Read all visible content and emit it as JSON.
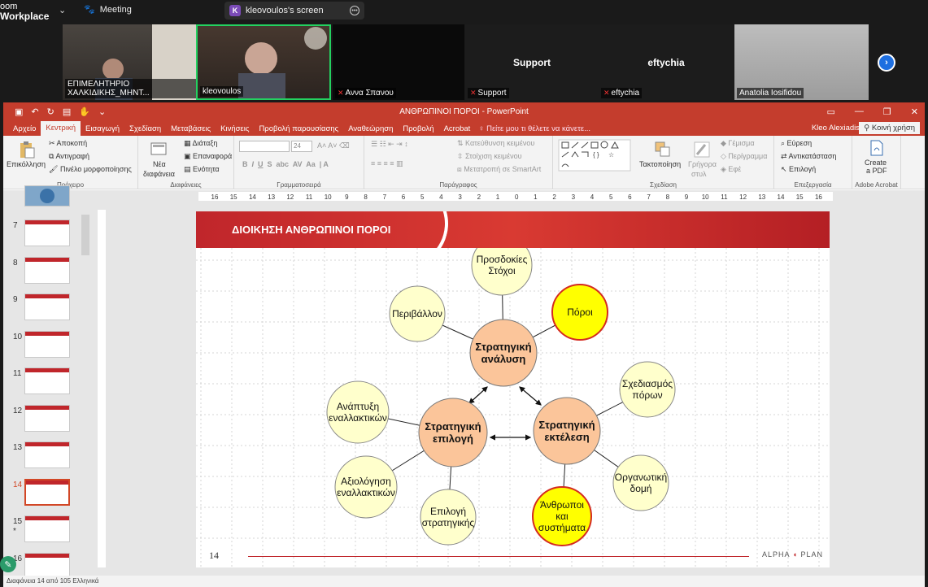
{
  "zoom": {
    "brand_top": "oom",
    "brand_bottom": "Workplace",
    "meeting_label": "Meeting",
    "share_label": "kleovoulos's screen",
    "share_initial": "K",
    "participants": [
      {
        "name": "ΕΠΙΜΕΛΗΤΗΡΙΟ ΧΑΛΚΙΔΙΚΗΣ_ΜΗΝΤ...",
        "big": "",
        "muted": false
      },
      {
        "name": "kleovoulos",
        "big": "",
        "muted": false
      },
      {
        "name": "Αννα Σπανου",
        "big": "",
        "muted": true
      },
      {
        "name": "Support",
        "big": "Support",
        "muted": true
      },
      {
        "name": "eftychia",
        "big": "eftychia",
        "muted": true
      },
      {
        "name": "Anatolia Iosifidou",
        "big": "",
        "muted": false
      }
    ]
  },
  "ppt": {
    "window_title": "ΑΝΘΡΩΠΙΝΟΙ ΠΟΡΟΙ - PowerPoint",
    "tabs": [
      "Αρχείο",
      "Κεντρική",
      "Εισαγωγή",
      "Σχεδίαση",
      "Μεταβάσεις",
      "Κινήσεις",
      "Προβολή παρουσίασης",
      "Αναθεώρηση",
      "Προβολή",
      "Acrobat"
    ],
    "active_tab": "Κεντρική",
    "tell_me": "Πείτε μου τι θέλετε να κάνετε...",
    "user": "Kleo Alexiadis",
    "share": "Κοινή χρήση",
    "ribbon": {
      "clipboard": {
        "paste": "Επικόλληση",
        "cut": "Αποκοπή",
        "copy": "Αντιγραφή",
        "painter": "Πινέλο μορφοποίησης",
        "label": "Πρόχειρο"
      },
      "slides": {
        "new": "Νέα",
        "new2": "διαφάνεια",
        "layout": "Διάταξη",
        "reset": "Επαναφορά",
        "section": "Ενότητα",
        "label": "Διαφάνειες"
      },
      "font": {
        "size": "24",
        "label": "Γραμματοσειρά"
      },
      "paragraph": {
        "direction": "Κατεύθυνση κειμένου",
        "align": "Στοίχιση κειμένου",
        "smartart": "Μετατροπή σε SmartArt",
        "label": "Παράγραφος"
      },
      "drawing": {
        "arrange": "Τακτοποίηση",
        "quick": "Γρήγορα",
        "quick2": "στυλ",
        "fill": "Γέμισμα",
        "outline": "Περίγραμμα",
        "effects": "Εφέ",
        "label": "Σχεδίαση"
      },
      "editing": {
        "find": "Εύρεση",
        "replace": "Αντικατάσταση",
        "select": "Επιλογή",
        "label": "Επεξεργασία"
      },
      "acrobat": {
        "create": "Create",
        "create2": "a PDF",
        "label": "Adobe Acrobat"
      }
    },
    "ruler_numbers": [
      "16",
      "15",
      "14",
      "13",
      "12",
      "11",
      "10",
      "9",
      "8",
      "7",
      "6",
      "5",
      "4",
      "3",
      "2",
      "1",
      "0",
      "1",
      "2",
      "3",
      "4",
      "5",
      "6",
      "7",
      "8",
      "9",
      "10",
      "11",
      "12",
      "13",
      "14",
      "15",
      "16"
    ],
    "thumbnails": [
      {
        "num": "7",
        "star": ""
      },
      {
        "num": "8",
        "star": ""
      },
      {
        "num": "9",
        "star": ""
      },
      {
        "num": "10",
        "star": ""
      },
      {
        "num": "11",
        "star": ""
      },
      {
        "num": "12",
        "star": ""
      },
      {
        "num": "13",
        "star": ""
      },
      {
        "num": "14",
        "star": ""
      },
      {
        "num": "15",
        "star": "*"
      },
      {
        "num": "16",
        "star": ""
      }
    ],
    "active_slide": "14",
    "status": "Διαφάνεια 14 από 105    Ελληνικά"
  },
  "slide": {
    "title": "ΔΙΟΙΚΗΣΗ ΑΝΘΡΩΠΙΝΟΙ ΠΟΡΟΙ",
    "page_number": "14",
    "logo_a": "ALPHA",
    "logo_b": "PLAN",
    "colors": {
      "light": "#ffffcc",
      "orange": "#fbc59a",
      "yellow": "#ffff00",
      "red": "#d42a1f"
    },
    "hubs": [
      {
        "line1": "Στρατηγική",
        "line2": "ανάλυση"
      },
      {
        "line1": "Στρατηγική",
        "line2": "επιλογή"
      },
      {
        "line1": "Στρατηγική",
        "line2": "εκτέλεση"
      }
    ],
    "nodes": [
      {
        "line1": "Προσδοκίες",
        "line2": "Στόχοι",
        "style": "light"
      },
      {
        "line1": "Περιβάλλον",
        "line2": "",
        "style": "light"
      },
      {
        "line1": "Πόροι",
        "line2": "",
        "style": "yellow"
      },
      {
        "line1": "Ανάπτυξη",
        "line2": "εναλλακτικών",
        "style": "light"
      },
      {
        "line1": "Αξιολόγηση",
        "line2": "εναλλακτικών",
        "style": "light"
      },
      {
        "line1": "Επιλογή",
        "line2": "στρατηγικής",
        "style": "light"
      },
      {
        "line1": "Σχεδιασμός",
        "line2": "πόρων",
        "style": "light"
      },
      {
        "line1": "Οργανωτική",
        "line2": "δομή",
        "style": "light"
      },
      {
        "line1": "Άνθρωποι",
        "line2": "και",
        "line3": "συστήματα",
        "style": "yellow"
      }
    ]
  }
}
